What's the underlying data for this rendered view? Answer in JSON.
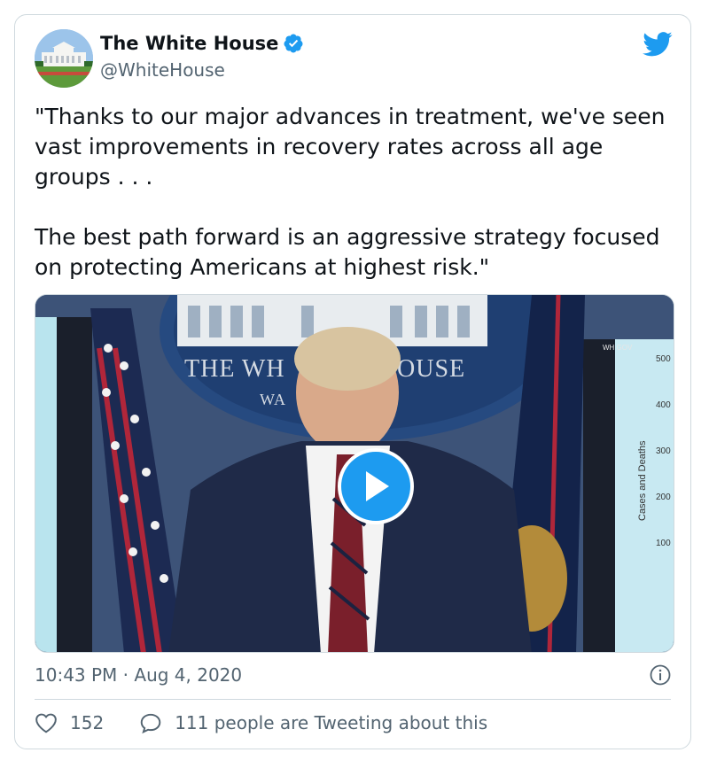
{
  "account": {
    "name": "The White House",
    "handle": "@WhiteHouse",
    "verified": true
  },
  "tweet": {
    "paragraph_1": "\"Thanks to our major advances in treatment, we've seen vast improvements in recovery rates across all age groups . . .",
    "paragraph_2": "The best path forward is an aggressive strategy focused on protecting Americans at highest risk.\"",
    "timestamp": "10:43 PM · Aug 4, 2020"
  },
  "media": {
    "type": "video",
    "backdrop_text_1": "THE WH",
    "backdrop_text_2": "OUSE",
    "backdrop_text_3": "WA",
    "whgov_text": "WH GOV",
    "chart_axis_label": "Cases and Deaths",
    "chart_ticks": [
      "500",
      "400",
      "300",
      "200",
      "100"
    ]
  },
  "stats": {
    "likes": "152",
    "tweeting_about": "111 people are Tweeting about this"
  },
  "colors": {
    "accent": "#1d9bf0",
    "text": "#0f1419",
    "secondary": "#536471",
    "border": "#cfd9de"
  },
  "icons": {
    "brand": "twitter-bird-icon",
    "verified": "verified-badge-icon",
    "play": "play-icon",
    "info": "info-icon",
    "like": "heart-icon",
    "reply": "speech-bubble-icon"
  }
}
